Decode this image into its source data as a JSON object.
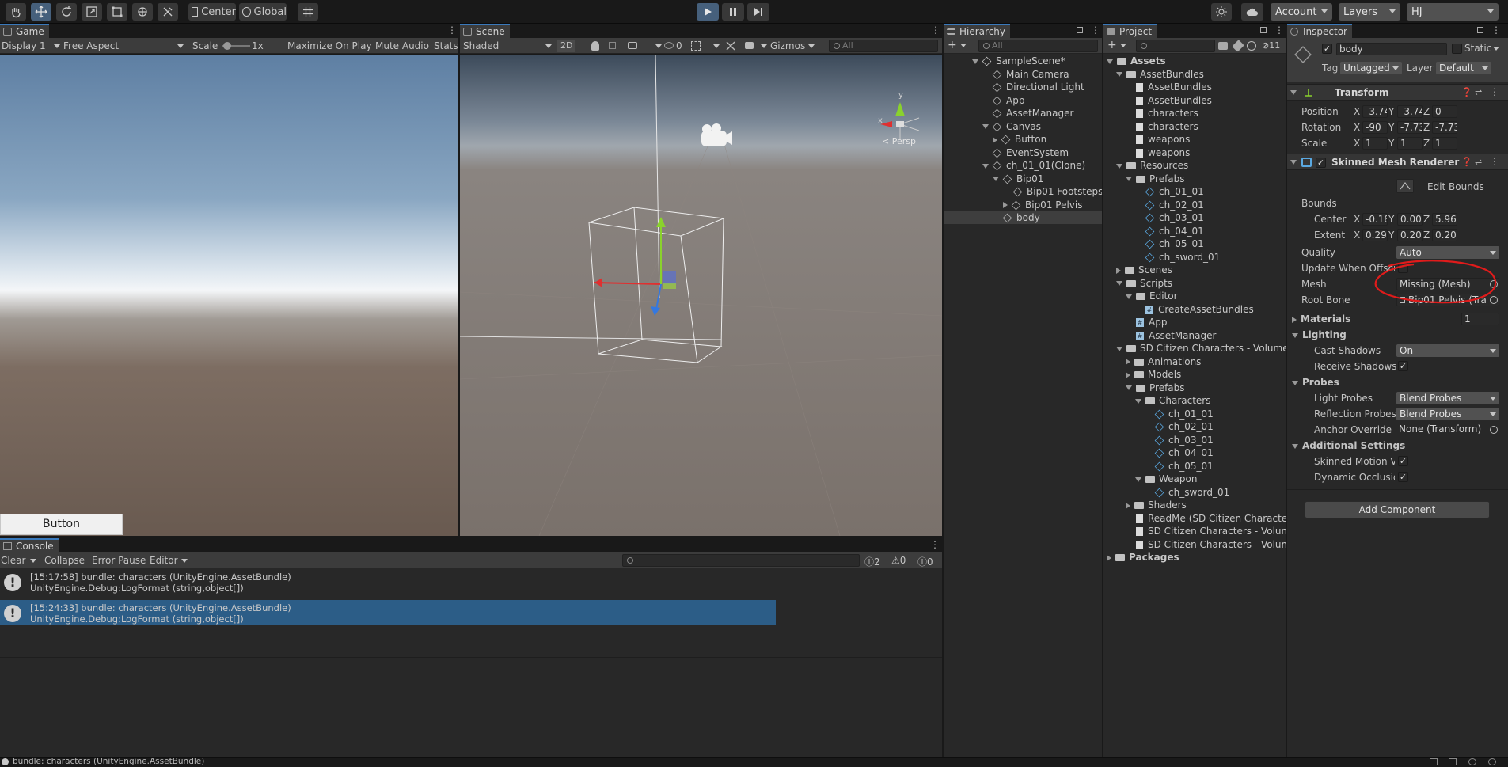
{
  "toolbar": {
    "pivot": "Center",
    "space": "Global",
    "account": "Account",
    "layers": "Layers",
    "layout": "HJ"
  },
  "game": {
    "tab": "Game",
    "display": "Display 1",
    "aspect": "Free Aspect",
    "scale_label": "Scale",
    "scale_value": "1x",
    "maximize": "Maximize On Play",
    "mute": "Mute Audio",
    "stats": "Stats",
    "button_label": "Button"
  },
  "scene": {
    "tab": "Scene",
    "shading": "Shaded",
    "mode2d": "2D",
    "hidden_count": "0",
    "gizmos": "Gizmos",
    "search_placeholder": "All",
    "persp": "< Persp",
    "gizmo_axes": {
      "y": "y",
      "x": "x"
    }
  },
  "hierarchy": {
    "tab": "Hierarchy",
    "search_placeholder": "All",
    "items": [
      {
        "label": "SampleScene*",
        "depth": 0,
        "kind": "scene",
        "fold": "open"
      },
      {
        "label": "Main Camera",
        "depth": 1,
        "kind": "go",
        "fold": "none"
      },
      {
        "label": "Directional Light",
        "depth": 1,
        "kind": "go",
        "fold": "none"
      },
      {
        "label": "App",
        "depth": 1,
        "kind": "go",
        "fold": "none"
      },
      {
        "label": "AssetManager",
        "depth": 1,
        "kind": "go",
        "fold": "none"
      },
      {
        "label": "Canvas",
        "depth": 1,
        "kind": "go",
        "fold": "open"
      },
      {
        "label": "Button",
        "depth": 2,
        "kind": "go",
        "fold": "closed"
      },
      {
        "label": "EventSystem",
        "depth": 1,
        "kind": "go",
        "fold": "none"
      },
      {
        "label": "ch_01_01(Clone)",
        "depth": 1,
        "kind": "go",
        "fold": "open"
      },
      {
        "label": "Bip01",
        "depth": 2,
        "kind": "go",
        "fold": "open"
      },
      {
        "label": "Bip01 Footsteps",
        "depth": 3,
        "kind": "go",
        "fold": "none"
      },
      {
        "label": "Bip01 Pelvis",
        "depth": 3,
        "kind": "go",
        "fold": "closed"
      },
      {
        "label": "body",
        "depth": 2,
        "kind": "go",
        "fold": "none",
        "selected": true
      }
    ]
  },
  "project": {
    "tab": "Project",
    "hidden_count": "11",
    "items": [
      {
        "label": "Assets",
        "depth": 0,
        "kind": "folder",
        "fold": "open",
        "bold": true
      },
      {
        "label": "AssetBundles",
        "depth": 1,
        "kind": "folder",
        "fold": "open"
      },
      {
        "label": "AssetBundles",
        "depth": 2,
        "kind": "file",
        "fold": "none"
      },
      {
        "label": "AssetBundles",
        "depth": 2,
        "kind": "file",
        "fold": "none"
      },
      {
        "label": "characters",
        "depth": 2,
        "kind": "file",
        "fold": "none"
      },
      {
        "label": "characters",
        "depth": 2,
        "kind": "file",
        "fold": "none"
      },
      {
        "label": "weapons",
        "depth": 2,
        "kind": "file",
        "fold": "none"
      },
      {
        "label": "weapons",
        "depth": 2,
        "kind": "file",
        "fold": "none"
      },
      {
        "label": "Resources",
        "depth": 1,
        "kind": "folder",
        "fold": "open"
      },
      {
        "label": "Prefabs",
        "depth": 2,
        "kind": "folder",
        "fold": "open"
      },
      {
        "label": "ch_01_01",
        "depth": 3,
        "kind": "prefab",
        "fold": "none"
      },
      {
        "label": "ch_02_01",
        "depth": 3,
        "kind": "prefab",
        "fold": "none"
      },
      {
        "label": "ch_03_01",
        "depth": 3,
        "kind": "prefab",
        "fold": "none"
      },
      {
        "label": "ch_04_01",
        "depth": 3,
        "kind": "prefab",
        "fold": "none"
      },
      {
        "label": "ch_05_01",
        "depth": 3,
        "kind": "prefab",
        "fold": "none"
      },
      {
        "label": "ch_sword_01",
        "depth": 3,
        "kind": "prefab",
        "fold": "none"
      },
      {
        "label": "Scenes",
        "depth": 1,
        "kind": "folder",
        "fold": "closed"
      },
      {
        "label": "Scripts",
        "depth": 1,
        "kind": "folder",
        "fold": "open"
      },
      {
        "label": "Editor",
        "depth": 2,
        "kind": "folder",
        "fold": "open"
      },
      {
        "label": "CreateAssetBundles",
        "depth": 3,
        "kind": "script",
        "fold": "none"
      },
      {
        "label": "App",
        "depth": 2,
        "kind": "script",
        "fold": "none"
      },
      {
        "label": "AssetManager",
        "depth": 2,
        "kind": "script",
        "fold": "none"
      },
      {
        "label": "SD Citizen Characters - Volume0",
        "depth": 1,
        "kind": "folder",
        "fold": "open"
      },
      {
        "label": "Animations",
        "depth": 2,
        "kind": "folder",
        "fold": "closed"
      },
      {
        "label": "Models",
        "depth": 2,
        "kind": "folder",
        "fold": "closed"
      },
      {
        "label": "Prefabs",
        "depth": 2,
        "kind": "folder",
        "fold": "open"
      },
      {
        "label": "Characters",
        "depth": 3,
        "kind": "folder",
        "fold": "open"
      },
      {
        "label": "ch_01_01",
        "depth": 4,
        "kind": "prefab",
        "fold": "none"
      },
      {
        "label": "ch_02_01",
        "depth": 4,
        "kind": "prefab",
        "fold": "none"
      },
      {
        "label": "ch_03_01",
        "depth": 4,
        "kind": "prefab",
        "fold": "none"
      },
      {
        "label": "ch_04_01",
        "depth": 4,
        "kind": "prefab",
        "fold": "none"
      },
      {
        "label": "ch_05_01",
        "depth": 4,
        "kind": "prefab",
        "fold": "none"
      },
      {
        "label": "Weapon",
        "depth": 3,
        "kind": "folder",
        "fold": "open"
      },
      {
        "label": "ch_sword_01",
        "depth": 4,
        "kind": "prefab",
        "fold": "none"
      },
      {
        "label": "Shaders",
        "depth": 2,
        "kind": "folder",
        "fold": "closed"
      },
      {
        "label": "ReadMe (SD Citizen Characte",
        "depth": 2,
        "kind": "file",
        "fold": "none"
      },
      {
        "label": "SD Citizen Characters - Volum",
        "depth": 2,
        "kind": "file",
        "fold": "none"
      },
      {
        "label": "SD Citizen Characters - Volum",
        "depth": 2,
        "kind": "file",
        "fold": "none"
      },
      {
        "label": "Packages",
        "depth": 0,
        "kind": "folder",
        "fold": "closed",
        "bold": true
      }
    ]
  },
  "inspector": {
    "tab": "Inspector",
    "object_name": "body",
    "static_label": "Static",
    "tag_label": "Tag",
    "tag_value": "Untagged",
    "layer_label": "Layer",
    "layer_value": "Default",
    "transform": {
      "title": "Transform",
      "position_label": "Position",
      "rotation_label": "Rotation",
      "scale_label": "Scale",
      "position": [
        "-3.743(",
        "-3.743(",
        "0"
      ],
      "rotation": [
        "-90",
        "-7.7309",
        "-7.7309"
      ],
      "scale": [
        "1",
        "1",
        "1"
      ]
    },
    "smr": {
      "title": "Skinned Mesh Renderer",
      "edit_bounds": "Edit Bounds",
      "bounds_label": "Bounds",
      "center_label": "Center",
      "extent_label": "Extent",
      "center": [
        "-0.186",
        "0.0019",
        "5.9604"
      ],
      "extent": [
        "0.2900",
        "0.2088",
        "0.2089"
      ],
      "quality_label": "Quality",
      "quality_value": "Auto",
      "update_offscreen_label": "Update When Offscr",
      "mesh_label": "Mesh",
      "mesh_value": "Missing (Mesh)",
      "root_bone_label": "Root Bone",
      "root_bone_value": "Bip01 Pelvis (Tra",
      "materials_label": "Materials",
      "materials_count": "1",
      "lighting_label": "Lighting",
      "cast_shadows_label": "Cast Shadows",
      "cast_shadows_value": "On",
      "receive_shadows_label": "Receive Shadows",
      "probes_label": "Probes",
      "light_probes_label": "Light Probes",
      "light_probes_value": "Blend Probes",
      "reflection_probes_label": "Reflection Probes",
      "reflection_probes_value": "Blend Probes",
      "anchor_override_label": "Anchor Override",
      "anchor_override_value": "None (Transform)",
      "additional_label": "Additional Settings",
      "skinned_motion_label": "Skinned Motion Ve",
      "dynamic_occlusion_label": "Dynamic Occlusio"
    },
    "add_component": "Add Component"
  },
  "console": {
    "tab": "Console",
    "clear": "Clear",
    "collapse": "Collapse",
    "error_pause": "Error Pause",
    "editor": "Editor",
    "info_count": "2",
    "warn_count": "0",
    "error_count": "0",
    "logs": [
      {
        "line1": "[15:17:58] bundle: characters (UnityEngine.AssetBundle)",
        "line2": "UnityEngine.Debug:LogFormat (string,object[])"
      },
      {
        "line1": "[15:24:33] bundle: characters (UnityEngine.AssetBundle)",
        "line2": "UnityEngine.Debug:LogFormat (string,object[])"
      }
    ]
  },
  "statusbar": {
    "text": "bundle: characters (UnityEngine.AssetBundle)"
  },
  "colors": {
    "accent": "#3a79bb",
    "selection": "#2c5d87",
    "play_active": "#46607c",
    "annotation": "#e01b1b"
  }
}
